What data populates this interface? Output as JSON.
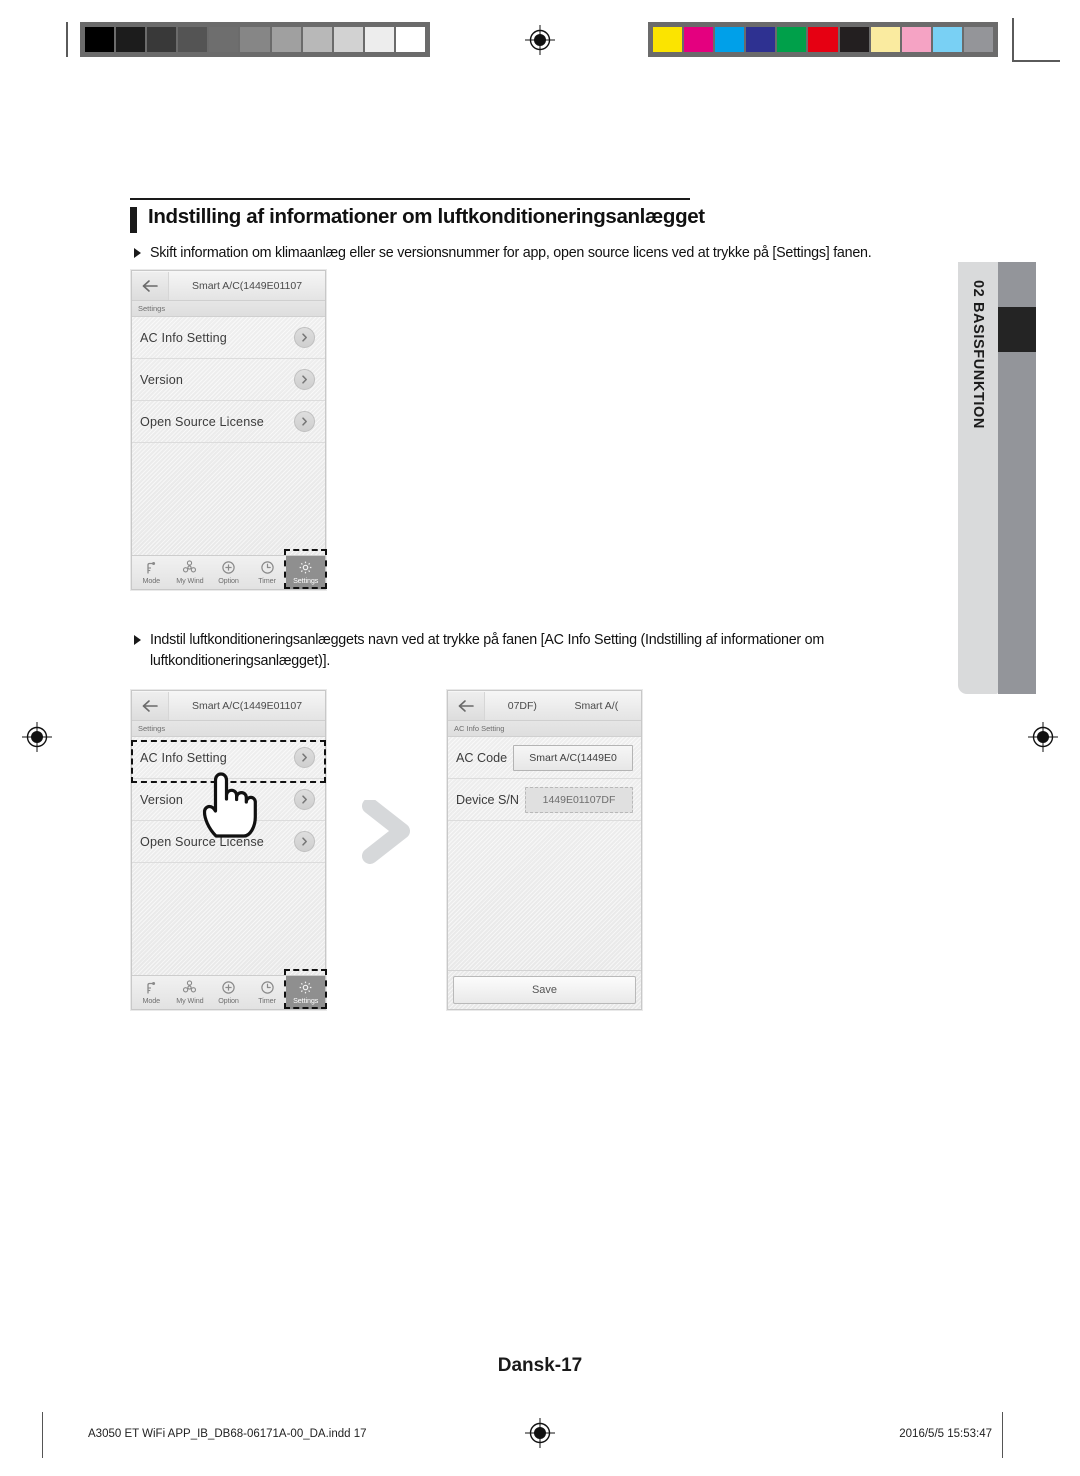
{
  "document": {
    "title": "Indstilling af informationer om luftkonditioneringsanlægget",
    "page_number_label": "Dansk-17",
    "side_tab": "02  BASISFUNKTION",
    "bullets": [
      "Skift information om klimaanlæg eller se versionsnummer for app, open source licens ved at trykke på  [Settings] fanen.",
      "Indstil luftkonditioneringsanlæggets navn ved at trykke på fanen [AC Info Setting (Indstilling af informationer om luftkonditioneringsanlægget)]."
    ]
  },
  "footer": {
    "filename": "A3050 ET WiFi APP_IB_DB68-06171A-00_DA.indd   17",
    "date": "2016/5/5   15:53:47"
  },
  "calibration": {
    "grayscale": [
      "#000000",
      "#1c1c1c",
      "#393939",
      "#545454",
      "#6e6e6e",
      "#868686",
      "#a0a0a0",
      "#b8b8b8",
      "#d2d2d2",
      "#ededed",
      "#ffffff"
    ],
    "colors": [
      "#fbe400",
      "#e4007f",
      "#00a0e9",
      "#2e3191",
      "#00a04a",
      "#e60012",
      "#231f20",
      "#faeba0",
      "#f5a3c4",
      "#79d0f4",
      "#949599"
    ]
  },
  "phone1": {
    "titlebar": {
      "back_icon": "back-arrow-icon",
      "title": "Smart A/C(1449E01107"
    },
    "subbar": "Settings",
    "rows": [
      {
        "label": "AC Info Setting",
        "chevron": "chevron-right-icon"
      },
      {
        "label": "Version",
        "chevron": "chevron-right-icon"
      },
      {
        "label": "Open Source License",
        "chevron": "chevron-right-icon"
      }
    ],
    "nav": [
      {
        "label": "Mode",
        "icon": "mode-icon",
        "active": false
      },
      {
        "label": "My Wind",
        "icon": "fan-icon",
        "active": false
      },
      {
        "label": "Option",
        "icon": "plus-circle-icon",
        "active": false
      },
      {
        "label": "Timer",
        "icon": "clock-icon",
        "active": false
      },
      {
        "label": "Settings",
        "icon": "gear-icon",
        "active": true
      }
    ]
  },
  "phone2": {
    "titlebar": {
      "back_icon": "back-arrow-icon",
      "title": "Smart A/C(1449E01107"
    },
    "subbar": "Settings",
    "rows": [
      {
        "label": "AC Info Setting",
        "chevron": "chevron-right-icon"
      },
      {
        "label": "Version",
        "chevron": "chevron-right-icon"
      },
      {
        "label": "Open Source License",
        "chevron": "chevron-right-icon"
      }
    ],
    "nav": [
      {
        "label": "Mode",
        "icon": "mode-icon",
        "active": false
      },
      {
        "label": "My Wind",
        "icon": "fan-icon",
        "active": false
      },
      {
        "label": "Option",
        "icon": "plus-circle-icon",
        "active": false
      },
      {
        "label": "Timer",
        "icon": "clock-icon",
        "active": false
      },
      {
        "label": "Settings",
        "icon": "gear-icon",
        "active": true
      }
    ],
    "tap_target": "AC Info Setting"
  },
  "phone3": {
    "titlebar": {
      "back_icon": "back-arrow-icon",
      "title_left": "07DF)",
      "title_right": "Smart A/("
    },
    "subbar": "AC Info Setting",
    "fields": [
      {
        "label": "AC Code",
        "value": "Smart A/C(1449E0",
        "readonly": false
      },
      {
        "label": "Device S/N",
        "value": "1449E01107DF",
        "readonly": true
      }
    ],
    "save_label": "Save"
  }
}
